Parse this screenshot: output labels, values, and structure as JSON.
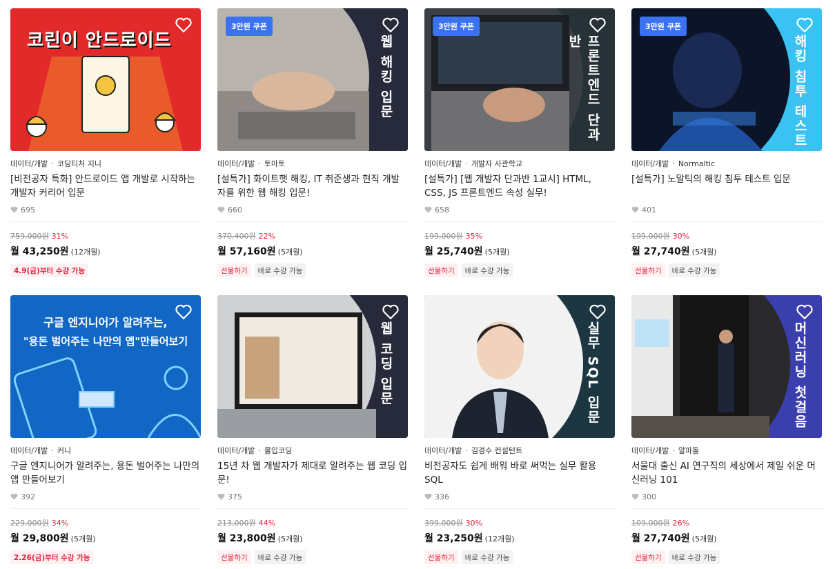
{
  "colors": {
    "accent_red": "#e3203b",
    "coupon_blue": "#3b72f2"
  },
  "courses": [
    {
      "coupon": "",
      "cover_title": "",
      "category": "데이터/개발",
      "instructor": "코딩티처 지니",
      "title": "[비전공자 특화] 안드로이드 앱 개발로 시작하는 개발자 커리어 입문",
      "likes": "695",
      "original_price": "759,000원",
      "discount": "31%",
      "monthly": "월 43,250원",
      "months": "(12개월)",
      "tags": [
        {
          "label": "4.9(금)부터 수강 가능",
          "kind": "date"
        }
      ],
      "cover_text": "코린이 안드로이드"
    },
    {
      "coupon": "3만원 쿠폰",
      "cover_title": "웹 해킹 입문",
      "category": "데이터/개발",
      "instructor": "토마토",
      "title": "[설특가] 화이트햇 해킹, IT 취준생과 현직 개발자를 위한 웹 해킹 입문!",
      "likes": "660",
      "original_price": "370,400원",
      "discount": "22%",
      "monthly": "월 57,160원",
      "months": "(5개월)",
      "tags": [
        {
          "label": "선물하기",
          "kind": "red"
        },
        {
          "label": "바로 수강 가능",
          "kind": "gray"
        }
      ]
    },
    {
      "coupon": "3만원 쿠폰",
      "cover_title": "프론트엔드 단과반",
      "category": "데이터/개발",
      "instructor": "개발자 사관학교",
      "title": "[설특가] [웹 개발자 단과반 1교시] HTML, CSS, JS 프론트엔드 속성 실무!",
      "likes": "658",
      "original_price": "199,000원",
      "discount": "35%",
      "monthly": "월 25,740원",
      "months": "(5개월)",
      "tags": [
        {
          "label": "선물하기",
          "kind": "red"
        },
        {
          "label": "바로 수강 가능",
          "kind": "gray"
        }
      ]
    },
    {
      "coupon": "3만원 쿠폰",
      "cover_title": "해킹 침투 테스트",
      "category": "데이터/개발",
      "instructor": "Normaltic",
      "title": "[설특가] 노말틱의 해킹 침투 테스트 입문",
      "likes": "401",
      "original_price": "199,000원",
      "discount": "30%",
      "monthly": "월 27,740원",
      "months": "(5개월)",
      "tags": [
        {
          "label": "선물하기",
          "kind": "red"
        },
        {
          "label": "바로 수강 가능",
          "kind": "gray"
        }
      ]
    },
    {
      "coupon": "",
      "cover_title": "",
      "category": "데이터/개발",
      "instructor": "커니",
      "title": "구글 엔지니어가 알려주는, 용돈 벌어주는 나만의 앱 만들어보기",
      "likes": "392",
      "original_price": "229,000원",
      "discount": "34%",
      "monthly": "월 29,800원",
      "months": "(5개월)",
      "tags": [
        {
          "label": "2.26(금)부터 수강 가능",
          "kind": "date"
        }
      ],
      "cover_text_1": "구글 엔지니어가 알려주는,",
      "cover_text_2": "\"용돈 벌어주는 나만의 앱\"만들어보기"
    },
    {
      "coupon": "",
      "cover_title": "웹 코딩 입문",
      "category": "데이터/개발",
      "instructor": "몰입코딩",
      "title": "15년 차 웹 개발자가 제대로 알려주는 웹 코딩 입문!",
      "likes": "375",
      "original_price": "213,000원",
      "discount": "44%",
      "monthly": "월 23,800원",
      "months": "(5개월)",
      "tags": [
        {
          "label": "선물하기",
          "kind": "red"
        },
        {
          "label": "바로 수강 가능",
          "kind": "gray"
        }
      ]
    },
    {
      "coupon": "",
      "cover_title": "실무 SQL 입문",
      "category": "데이터/개발",
      "instructor": "김경수 컨설턴트",
      "title": "비전공자도 쉽게 배워 바로 써먹는 실무 활용 SQL",
      "likes": "336",
      "original_price": "399,000원",
      "discount": "30%",
      "monthly": "월 23,250원",
      "months": "(12개월)",
      "tags": [
        {
          "label": "선물하기",
          "kind": "red"
        },
        {
          "label": "바로 수강 가능",
          "kind": "gray"
        }
      ]
    },
    {
      "coupon": "",
      "cover_title": "머신러닝 첫걸음",
      "category": "데이터/개발",
      "instructor": "알파돌",
      "title": "서울대 출신 AI 연구직의 세상에서 제일 쉬운 머신러닝 101",
      "likes": "300",
      "original_price": "109,000원",
      "discount": "26%",
      "monthly": "월 27,740원",
      "months": "(5개월)",
      "tags": [
        {
          "label": "선물하기",
          "kind": "red"
        },
        {
          "label": "바로 수강 가능",
          "kind": "gray"
        }
      ]
    }
  ]
}
